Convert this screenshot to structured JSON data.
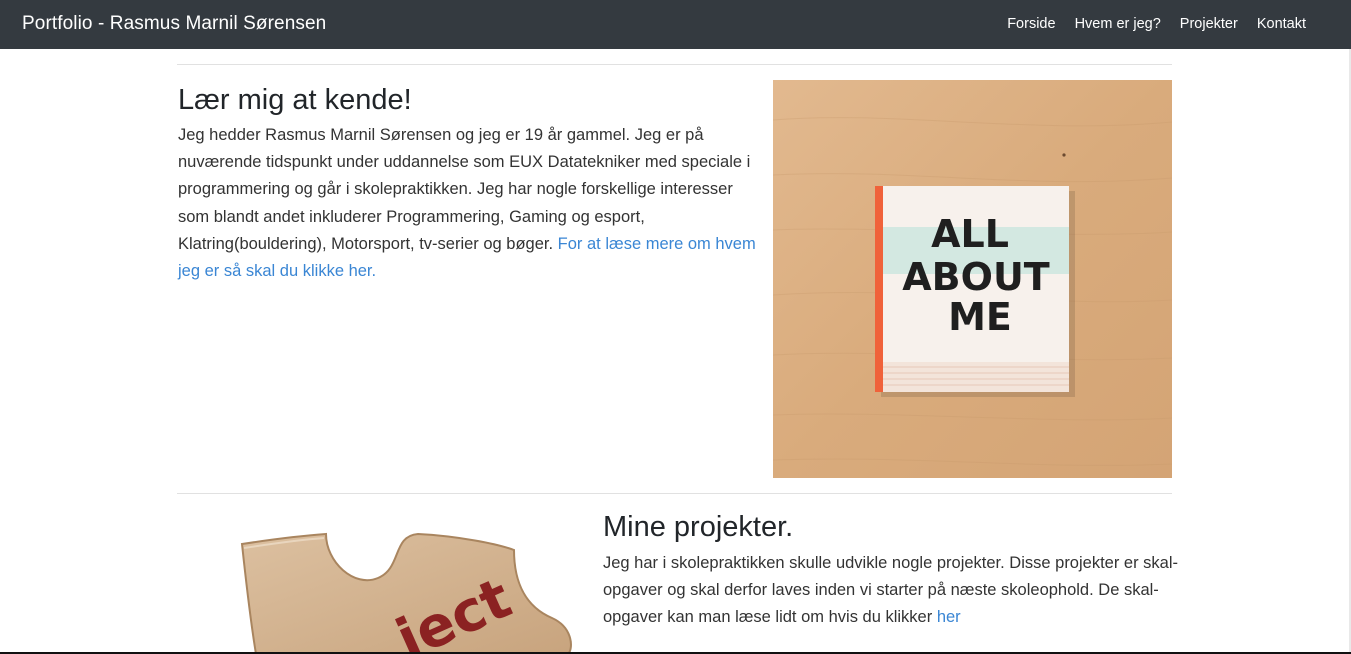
{
  "navbar": {
    "brand": "Portfolio - Rasmus Marnil Sørensen",
    "links": [
      "Forside",
      "Hvem er jeg?",
      "Projekter",
      "Kontakt"
    ]
  },
  "about": {
    "title": "Lær mig at kende!",
    "text": "Jeg hedder Rasmus Marnil Sørensen og jeg er 19 år gammel. Jeg er på nuværende tidspunkt under uddannelse som EUX Datatekniker med speciale i programmering og går i skolepraktikken. Jeg har nogle forskellige interesser som blandt andet inkluderer Programmering, Gaming og esport, Klatring(bouldering), Motorsport, tv-serier og bøger.",
    "link_text": "For at læse mere om hvem jeg er så skal du klikke her.",
    "image": {
      "book_text_line1": "ALL",
      "book_text_line2": "ABOUT",
      "book_text_line3": "ME"
    }
  },
  "projects": {
    "title": "Mine projekter.",
    "text": "Jeg har i skolepraktikken skulle udvikle nogle projekter. Disse projekter er skal-opgaver og skal derfor laves inden vi starter på næste skoleophold. De skal-opgaver kan man læse lidt om hvis du klikker",
    "link_text": "her",
    "image": {
      "puzzle_text": "ject"
    }
  },
  "colors": {
    "navbar_bg": "#343a40",
    "link": "#3a86d4",
    "wood": "#dcb184",
    "book_spine": "#f0623a",
    "book_band": "#d3e8e1",
    "puzzle_text": "#8b2222"
  }
}
